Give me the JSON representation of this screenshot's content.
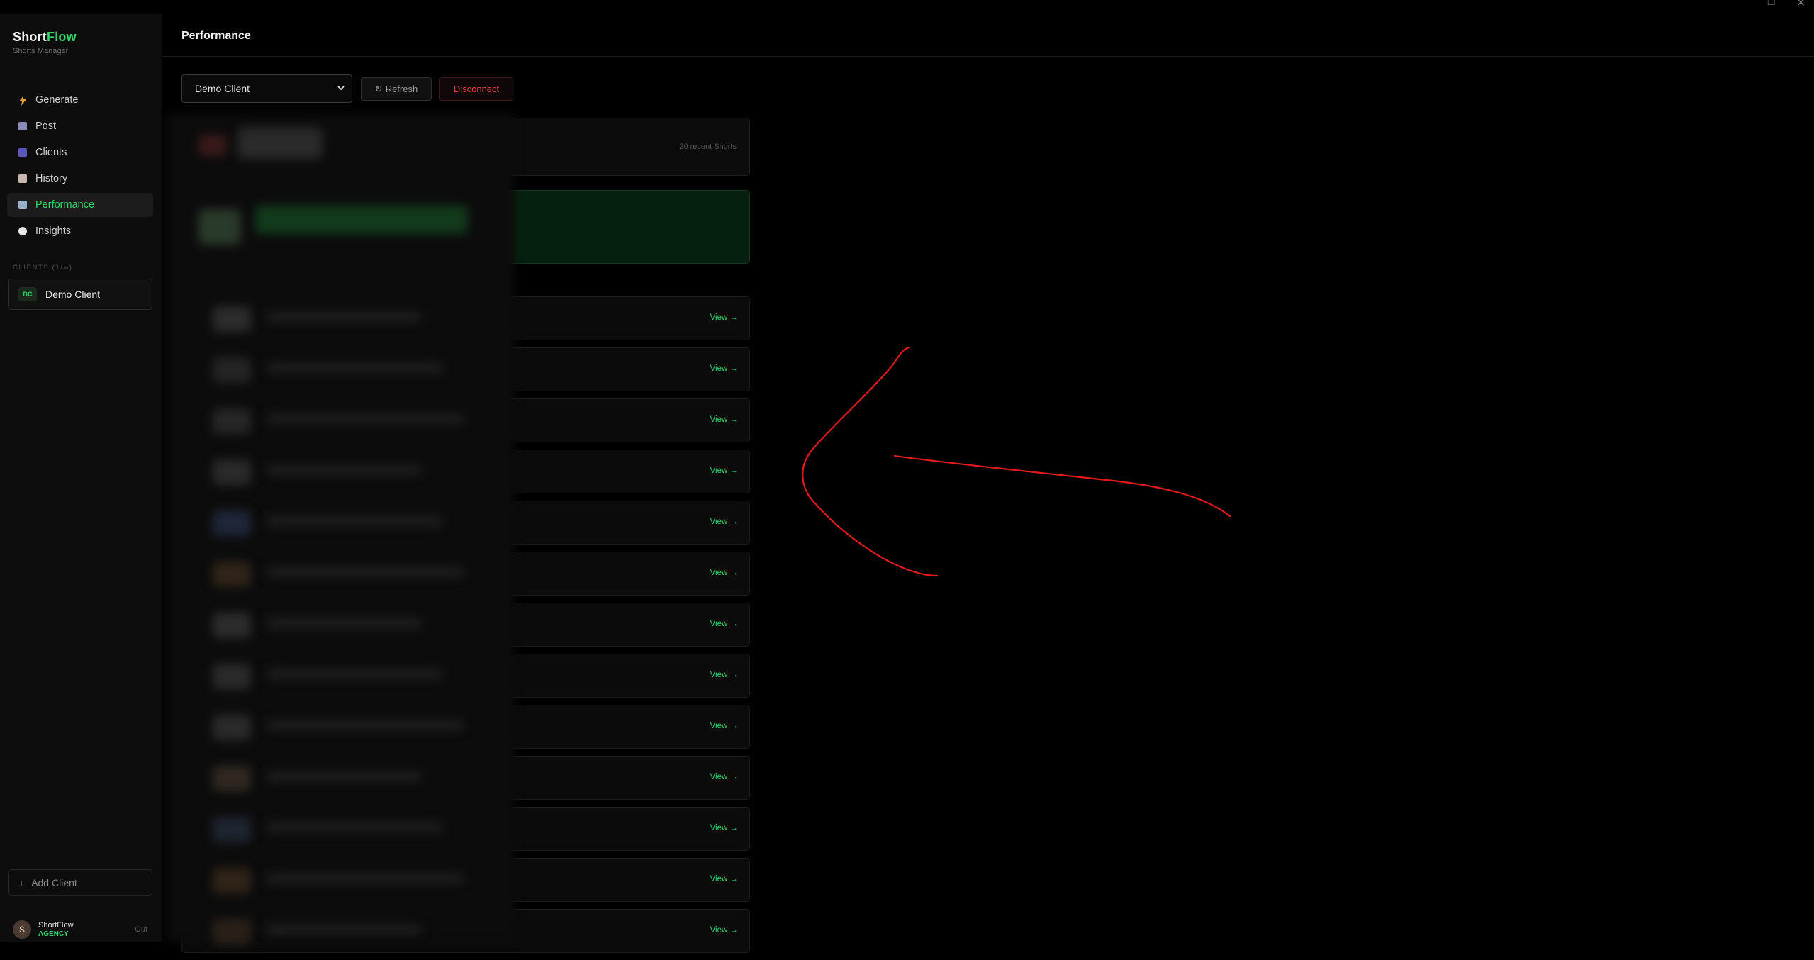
{
  "app": {
    "brand_prefix": "Short",
    "brand_accent": "Flow",
    "brand_subtitle": "Shorts Manager",
    "accent_color": "#34d46a"
  },
  "window_controls": [
    "□",
    "✕"
  ],
  "sidebar": {
    "nav": [
      {
        "label": "Generate",
        "icon": "bolt-icon"
      },
      {
        "label": "Post",
        "icon": "clapper-icon"
      },
      {
        "label": "Clients",
        "icon": "users-icon"
      },
      {
        "label": "History",
        "icon": "clipboard-icon"
      },
      {
        "label": "Performance",
        "icon": "chart-icon",
        "active": true
      },
      {
        "label": "Insights",
        "icon": "chat-bubble-icon"
      }
    ],
    "clients_label": "CLIENTS (1/∞)",
    "client": {
      "badge": "DC",
      "name": "Demo Client"
    },
    "add_client": "Add Client",
    "add_client_icon": "+",
    "user": {
      "initial": "S",
      "name": "ShortFlow",
      "plan": "AGENCY",
      "out": "Out"
    }
  },
  "main": {
    "title": "Performance",
    "client_select": {
      "value": "Demo Client"
    },
    "refresh_icon": "↻",
    "refresh_label": "Refresh",
    "disconnect_label": "Disconnect",
    "channel_count": "20 recent Shorts",
    "view_label": "View →",
    "row_count": 13
  }
}
